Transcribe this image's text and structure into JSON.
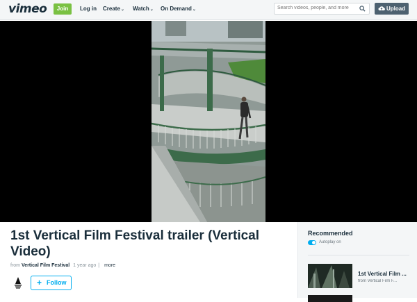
{
  "header": {
    "logo": "vimeo",
    "join_label": "Join",
    "nav": [
      {
        "label": "Log in",
        "has_menu": false
      },
      {
        "label": "Create",
        "has_menu": true
      },
      {
        "label": "Watch",
        "has_menu": true
      },
      {
        "label": "On Demand",
        "has_menu": true
      }
    ],
    "search_placeholder": "Search videos, people, and more",
    "upload_label": "Upload"
  },
  "video": {
    "title": "1st Vertical Film Festival trailer (Vertical Video)",
    "from_label": "from",
    "owner": "Vertical Film Festival",
    "age": "1 year ago",
    "more_label": "more",
    "follow_label": "Follow"
  },
  "sidebar": {
    "heading": "Recommended",
    "autoplay_label": "Autoplay on",
    "autoplay_on": true,
    "items": [
      {
        "title": "1st Vertical Film ...",
        "owner": "from Vertical Film F..."
      }
    ]
  },
  "colors": {
    "join": "#7ac143",
    "accent": "#00adef",
    "upload": "#4d6170",
    "text": "#1a2e3b"
  }
}
